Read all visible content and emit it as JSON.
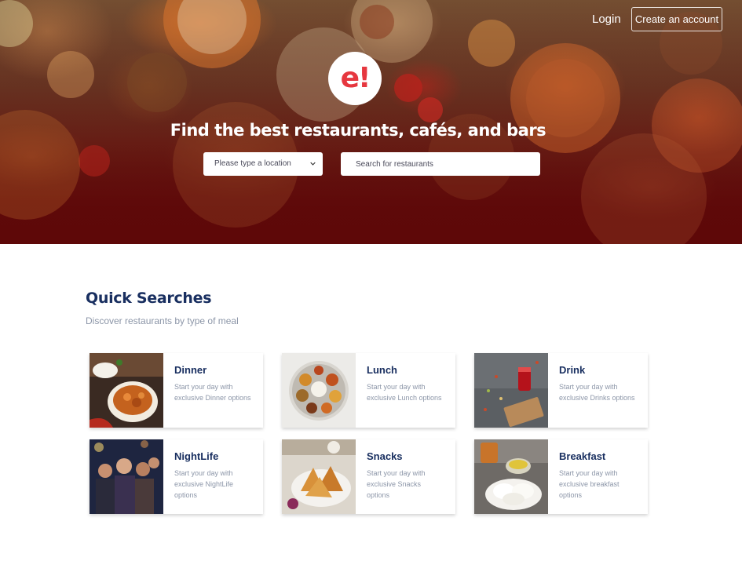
{
  "header": {
    "login_label": "Login",
    "signup_label": "Create an account"
  },
  "brand": {
    "logo_text": "e!",
    "logo_color": "#e6373f"
  },
  "hero": {
    "headline": "Find the best restaurants, cafés, and bars",
    "location_placeholder": "Please type a location",
    "search_placeholder": "Search for restaurants"
  },
  "quick_searches": {
    "title": "Quick Searches",
    "subtitle": "Discover restaurants by type of meal",
    "items": [
      {
        "title": "Dinner",
        "description": "Start your day with exclusive Dinner options",
        "image": "dinner-curry-bowl"
      },
      {
        "title": "Lunch",
        "description": "Start your day with exclusive Lunch options",
        "image": "lunch-thali-platter"
      },
      {
        "title": "Drink",
        "description": "Start your day with exclusive Drinks options",
        "image": "drink-tea-glass"
      },
      {
        "title": "NightLife",
        "description": "Start your day with exclusive NightLife options",
        "image": "nightlife-party-crowd"
      },
      {
        "title": "Snacks",
        "description": "Start your day with exclusive Snacks options",
        "image": "snacks-samosa-plate"
      },
      {
        "title": "Breakfast",
        "description": "Start your day with exclusive breakfast options",
        "image": "breakfast-idli-plate"
      }
    ]
  },
  "colors": {
    "accent_red": "#e6373f",
    "heading_navy": "#192f60",
    "muted_text": "#8c96a8",
    "hero_bottom": "#5f0b0b"
  }
}
